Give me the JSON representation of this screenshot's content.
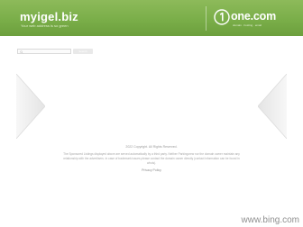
{
  "header": {
    "title": "myigel.biz",
    "tagline": "Your web address is so green",
    "brand_name": "one.com",
    "brand_tagline": "domain · hosting · email",
    "colors": {
      "green": "#7aae49",
      "white": "#ffffff"
    },
    "logo_icon": "one-com-logo-icon"
  },
  "search": {
    "placeholder": "",
    "button_label": "Search",
    "icon": "search-icon"
  },
  "carousel": {
    "prev_icon": "chevron-left-icon",
    "next_icon": "chevron-right-icon"
  },
  "footer": {
    "copyright": "2022 Copyright. All Rights Reserved.",
    "disclaimer": "The Sponsored Listings displayed above are served automatically by a third party. Neither Parkingcrew nor the domain owner maintain any relationship with the advertisers. In case of trademark issues please contact the domain owner directly (contact information can be found in whois).",
    "privacy_label": "Privacy Policy"
  },
  "watermark": "www.bing.com"
}
